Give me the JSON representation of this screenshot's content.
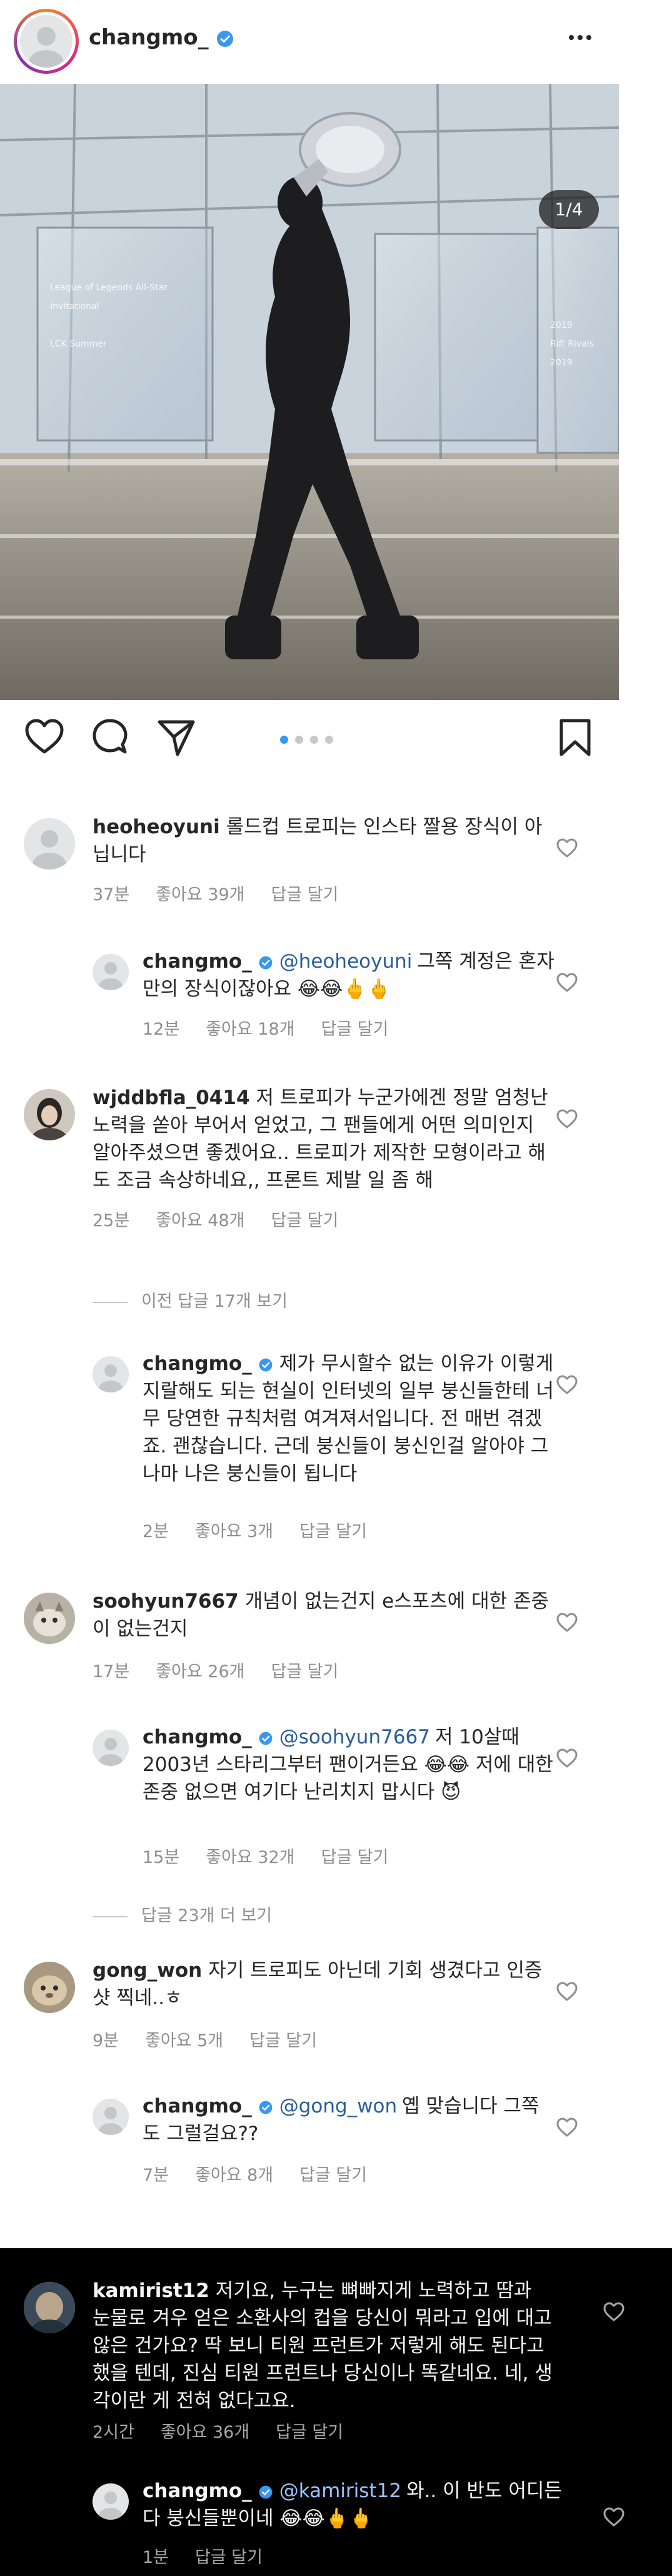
{
  "header": {
    "username": "changmo_"
  },
  "post": {
    "counter": "1/4"
  },
  "comments": [
    {
      "username": "heoheoyuni",
      "text": "롤드컵 트로피는 인스타 짤용 장식이 아닙니다",
      "time": "37분",
      "likes": "좋아요 39개",
      "reply": "답글 달기"
    },
    {
      "username": "changmo_",
      "mention": "@heoheoyuni",
      "text": "그쪽 계정은 혼자만의 장식이잖아요 😂😂🖕🖕",
      "time": "12분",
      "likes": "좋아요 18개",
      "reply": "답글 달기"
    },
    {
      "username": "wjddbfla_0414",
      "text": "저 트로피가 누군가에겐 정말 엄청난 노력을 쏟아 부어서 얻었고, 그 팬들에게 어떤 의미인지 알아주셨으면 좋겠어요.. 트로피가 제작한 모형이라고 해도 조금 속상하네요,, 프론트 제발 일 좀 해",
      "time": "25분",
      "likes": "좋아요 48개",
      "reply": "답글 달기"
    },
    {
      "view_replies": "이전 답글 17개 보기"
    },
    {
      "username": "changmo_",
      "text": "제가 무시할수 없는 이유가 이렇게 지랄해도 되는 현실이 인터넷의 일부 붕신들한테 너무 당연한 규칙처럼 여겨져서입니다. 전 매번 겪겠죠. 괜찮습니다. 근데 붕신들이 붕신인걸 알아야 그나마 나은 붕신들이 됩니다",
      "time": "2분",
      "likes": "좋아요 3개",
      "reply": "답글 달기"
    },
    {
      "username": "soohyun7667",
      "text": "개념이 없는건지 e스포츠에 대한 존중이 없는건지",
      "time": "17분",
      "likes": "좋아요 26개",
      "reply": "답글 달기"
    },
    {
      "username": "changmo_",
      "mention": "@soohyun7667",
      "text": "저 10살때 2003년 스타리그부터 팬이거든요 😂😂 저에 대한 존중 없으면 여기다 난리치지 맙시다 😈",
      "time": "15분",
      "likes": "좋아요 32개",
      "reply": "답글 달기"
    },
    {
      "view_replies": "답글 23개 더 보기"
    },
    {
      "username": "gong_won",
      "text": "자기 트로피도 아닌데 기회 생겼다고 인증샷 찍네..ㅎ",
      "time": "9분",
      "likes": "좋아요 5개",
      "reply": "답글 달기"
    },
    {
      "username": "changmo_",
      "mention": "@gong_won",
      "text": "옙 맞습니다 그쪽도 그럴걸요??",
      "time": "7분",
      "likes": "좋아요 8개",
      "reply": "답글 달기"
    },
    {
      "username": "kamirist12",
      "text": "저기요, 누구는 뼈빠지게 노력하고 땀과 눈물로 겨우 얻은 소환사의 컵을 당신이 뭐라고 입에 대고 않은 건가요? 딱 보니 티원 프런트가 저렇게 해도 된다고 했을 텐데, 진심 티원 프런트나 당신이나 똑같네요. 네, 생각이란 게 전혀 없다고요.",
      "time": "2시간",
      "likes": "좋아요 36개",
      "reply": "답글 달기"
    },
    {
      "username": "changmo_",
      "mention": "@kamirist12",
      "text": "와.. 이 반도 어디든 다 붕신들뿐이네 😂😂🖕🖕",
      "time": "1분",
      "reply": "답글 달기"
    }
  ],
  "colors": {
    "verified": "#3897f0",
    "mention": "#2a5e9b",
    "dark_panel": "#000000"
  },
  "icons": [
    "more-icon",
    "heart-icon",
    "comment-icon",
    "share-icon",
    "bookmark-icon",
    "user-tag-icon",
    "verified-badge-icon"
  ]
}
